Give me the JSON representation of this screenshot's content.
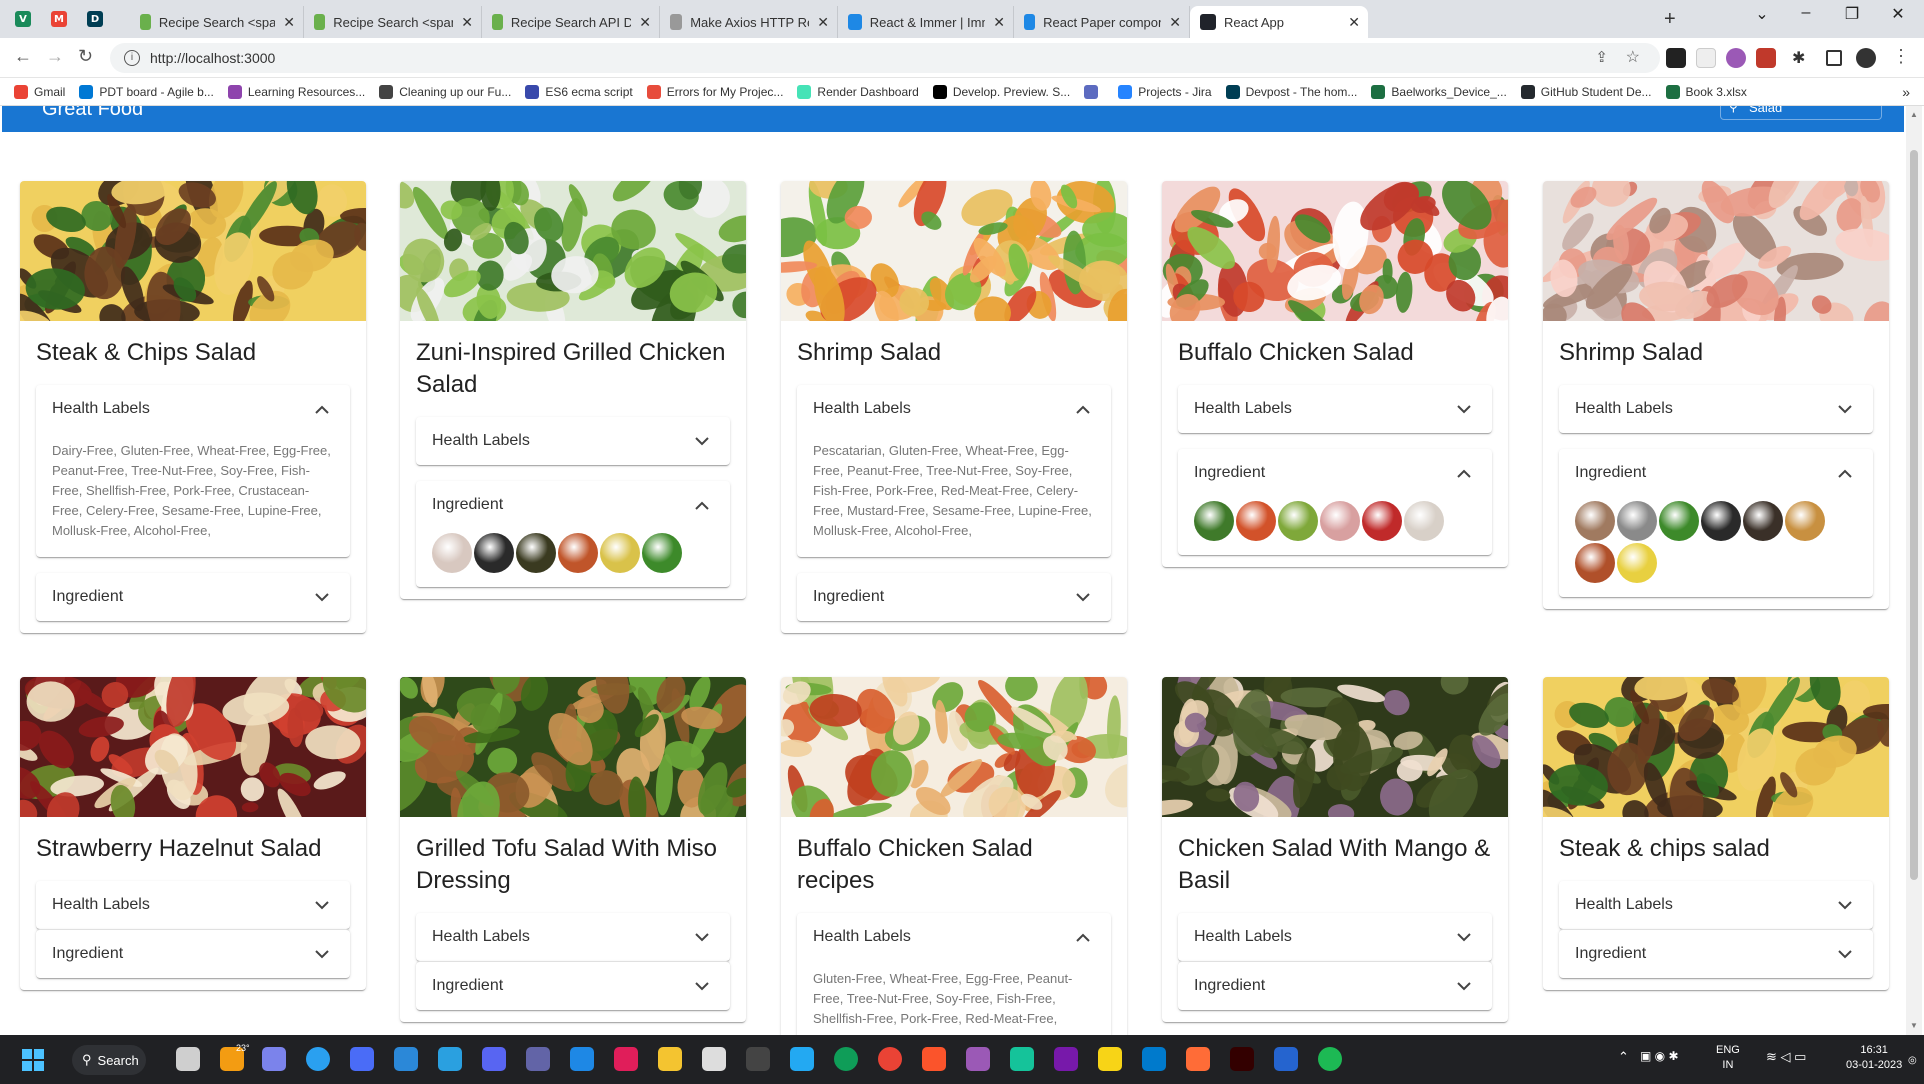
{
  "browser": {
    "pinned_tabs": [
      {
        "icon": "vue-icon",
        "color": "#1a8a5a",
        "glyph": "V"
      },
      {
        "icon": "gmail-icon",
        "color": "#ea4335",
        "glyph": "M"
      },
      {
        "icon": "devpost-icon",
        "color": "#003e54",
        "glyph": "D"
      }
    ],
    "tabs": [
      {
        "title": "Recipe Search <span class=\"",
        "icon": "edamam-icon",
        "color": "#6ab04c",
        "active": false
      },
      {
        "title": "Recipe Search <span class=\"",
        "icon": "edamam-icon",
        "color": "#6ab04c",
        "active": false
      },
      {
        "title": "Recipe Search API Demo by E",
        "icon": "edamam-icon",
        "color": "#6ab04c",
        "active": false
      },
      {
        "title": "Make Axios HTTP Request",
        "icon": "axios-icon",
        "color": "#999999",
        "active": false
      },
      {
        "title": "React & Immer | Immer",
        "icon": "immer-icon",
        "color": "#1e88e5",
        "active": false
      },
      {
        "title": "React Paper component - Ma",
        "icon": "mui-icon",
        "color": "#1e88e5",
        "active": false
      },
      {
        "title": "React App",
        "icon": "react-icon",
        "color": "#20232a",
        "active": true
      }
    ],
    "url": "http://localhost:3000",
    "bookmarks": [
      {
        "label": "Gmail",
        "icon": "gmail-icon",
        "color": "#ea4335"
      },
      {
        "label": "PDT board - Agile b...",
        "icon": "azure-icon",
        "color": "#0078d4"
      },
      {
        "label": "Learning Resources...",
        "icon": "learning-icon",
        "color": "#8e44ad"
      },
      {
        "label": "Cleaning up our Fu...",
        "icon": "mask-icon",
        "color": "#444444"
      },
      {
        "label": "ES6 ecma script",
        "icon": "floppy-icon",
        "color": "#3949ab"
      },
      {
        "label": "Errors for My Projec...",
        "icon": "sentry-icon",
        "color": "#e74c3c"
      },
      {
        "label": "Render Dashboard",
        "icon": "render-icon",
        "color": "#46e3b7"
      },
      {
        "label": "Develop. Preview. S...",
        "icon": "vercel-icon",
        "color": "#000000"
      },
      {
        "label": "",
        "icon": "diamond-icon",
        "color": "#5c6bc0"
      },
      {
        "label": "Projects - Jira",
        "icon": "jira-icon",
        "color": "#2684ff"
      },
      {
        "label": "Devpost - The hom...",
        "icon": "devpost-icon",
        "color": "#003e54"
      },
      {
        "label": "Baelworks_Device_...",
        "icon": "excel-icon",
        "color": "#1d6f42"
      },
      {
        "label": "GitHub Student De...",
        "icon": "github-icon",
        "color": "#24292e"
      },
      {
        "label": "Book 3.xlsx",
        "icon": "excel-icon",
        "color": "#1d6f42"
      }
    ]
  },
  "app": {
    "title": "Great Food",
    "search_label": "Salad",
    "accent": "#1976d2",
    "health_label_title": "Health Labels",
    "ingredient_title": "Ingredient",
    "recipes": [
      {
        "title": "Steak & Chips Salad",
        "image": "steak",
        "health_open": true,
        "health_text": "Dairy-Free, Gluten-Free, Wheat-Free, Egg-Free, Peanut-Free, Tree-Nut-Free, Soy-Free, Fish-Free, Shellfish-Free, Pork-Free, Crustacean-Free, Celery-Free, Sesame-Free, Lupine-Free, Mollusk-Free, Alcohol-Free,",
        "ingredient_open": false,
        "ingredient_thumbs": []
      },
      {
        "title": "Zuni-Inspired Grilled Chicken Salad",
        "image": "greens",
        "health_open": false,
        "health_text": "",
        "ingredient_open": true,
        "ingredient_thumbs": [
          "#d8c8c0",
          "#2a2a2a",
          "#3a3a20",
          "#c0552a",
          "#d9c24a",
          "#3d8a2a"
        ]
      },
      {
        "title": "Shrimp Salad",
        "image": "shrimp-chickpea",
        "health_open": true,
        "health_text": "Pescatarian, Gluten-Free, Wheat-Free, Egg-Free, Peanut-Free, Tree-Nut-Free, Soy-Free, Fish-Free, Pork-Free, Red-Meat-Free, Celery-Free, Mustard-Free, Sesame-Free, Lupine-Free, Mollusk-Free, Alcohol-Free,",
        "ingredient_open": false,
        "ingredient_thumbs": []
      },
      {
        "title": "Buffalo Chicken Salad",
        "image": "buffalo",
        "health_open": false,
        "health_text": "",
        "ingredient_open": true,
        "ingredient_thumbs": [
          "#3f7a2a",
          "#d2522a",
          "#7fa83a",
          "#d8a0a0",
          "#c02a2a",
          "#d8d0c8"
        ]
      },
      {
        "title": "Shrimp Salad",
        "image": "shrimp-bowl",
        "health_open": false,
        "health_text": "",
        "ingredient_open": true,
        "ingredient_thumbs": [
          "#a07a60",
          "#8a8a8a",
          "#3d8a2a",
          "#2a2a2a",
          "#3a3028",
          "#c89040",
          "#b0502a",
          "#e8d040"
        ]
      },
      {
        "title": "Strawberry Hazelnut Salad",
        "image": "strawberry",
        "health_open": false,
        "health_text": "",
        "ingredient_open": false,
        "ingredient_thumbs": []
      },
      {
        "title": "Grilled Tofu Salad With Miso Dressing",
        "image": "tofu",
        "health_open": false,
        "health_text": "",
        "ingredient_open": false,
        "ingredient_thumbs": []
      },
      {
        "title": "Buffalo Chicken Salad recipes",
        "image": "buffalo2",
        "health_open": true,
        "health_text": "Gluten-Free, Wheat-Free, Egg-Free, Peanut-Free, Tree-Nut-Free, Soy-Free, Fish-Free, Shellfish-Free, Pork-Free, Red-Meat-Free,",
        "ingredient_open": false,
        "ingredient_thumbs": []
      },
      {
        "title": "Chicken Salad With Mango & Basil",
        "image": "mango",
        "health_open": false,
        "health_text": "",
        "ingredient_open": false,
        "ingredient_thumbs": []
      },
      {
        "title": "Steak & chips salad",
        "image": "steak",
        "health_open": false,
        "health_text": "",
        "ingredient_open": false,
        "ingredient_thumbs": []
      }
    ]
  },
  "taskbar": {
    "search_label": "Search",
    "weather_temp": "23°",
    "language": "ENG",
    "region": "IN",
    "time": "16:31",
    "date": "03-01-2023"
  }
}
